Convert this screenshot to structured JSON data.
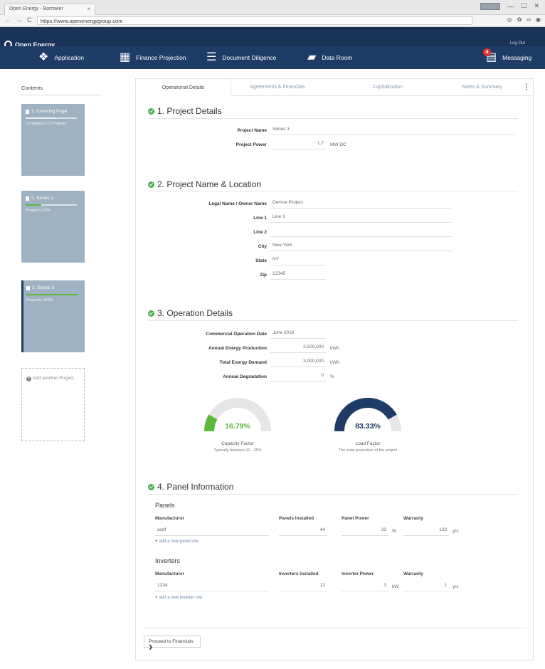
{
  "browser": {
    "tab_title": "Open Energy - Borrower",
    "tab_close": "×",
    "url": "https://www.openenergygroup.com",
    "nav_back": "←",
    "nav_forward": "→",
    "nav_reload": "C",
    "win_min": "—",
    "win_max": "☐",
    "win_close": "✕"
  },
  "app": {
    "brand": "Open Energy",
    "logout": "Log Out"
  },
  "nav": {
    "application": "Application",
    "finance_projection": "Finance Projection",
    "document_diligence": "Document Diligence",
    "data_room": "Data Room",
    "messaging": "Messaging",
    "message_count": "4"
  },
  "sidebar": {
    "contents_label": "Contents",
    "projects": [
      {
        "title": "1. Covering Page",
        "status": "Completed 1/2 Projects",
        "progress": 0.6
      },
      {
        "title": "2. Series 2",
        "status": "Progress 30%",
        "progress": 0.3
      },
      {
        "title": "3. Series 3",
        "status": "Progress 100%",
        "progress": 1.0
      }
    ],
    "add_project": "Add another Project"
  },
  "tabs": {
    "operational": "Operational Details",
    "agreements": "Agreements & Financials",
    "capitalization": "Capitalization",
    "notes": "Notes & Summary",
    "menu": "⋮"
  },
  "section1": {
    "title": "1. Project Details",
    "project_name_label": "Project Name",
    "project_name": "Series 3",
    "project_power_label": "Project Power",
    "project_power": "1.7",
    "project_power_unit": "MW DC"
  },
  "section2": {
    "title": "2. Project Name & Location",
    "legal_name_label": "Legal Name / Owner Name",
    "legal_name": "Demoe Project",
    "line1_label": "Line 1",
    "line1": "Line 1",
    "line2_label": "Line 2",
    "line2": "",
    "city_label": "City",
    "city": "New York",
    "state_label": "State",
    "state": "NY",
    "zip_label": "Zip",
    "zip": "12345"
  },
  "section3": {
    "title": "3. Operation Details",
    "cod_label": "Commercial Operation Date",
    "cod": "June 2016",
    "aep_label": "Annual Energy Production",
    "aep": "2,500,000",
    "aep_unit": "kWh",
    "ted_label": "Total Energy Demand",
    "ted": "3,000,000",
    "ted_unit": "kWh",
    "deg_label": "Annual Degradation",
    "deg": "0",
    "deg_unit": "%",
    "capacity": {
      "value": "16.79%",
      "fraction": 0.1679,
      "label": "Capacity Factor",
      "sub": "Typically between 10 - 25%",
      "color": "#5cb83d"
    },
    "load": {
      "value": "83.33%",
      "fraction": 0.8333,
      "label": "Load Factor",
      "sub": "The solar proportion of the project",
      "color": "#1f3c66"
    }
  },
  "section4": {
    "title": "4. Panel Information",
    "panels_title": "Panels",
    "manufacturer_head": "Manufacturer",
    "panels_installed_head": "Panels Installed",
    "panel_power_head": "Panel Power",
    "warranty_head": "Warranty",
    "panel_row": {
      "manufacturer": "asdf",
      "installed": "44",
      "power": "33",
      "power_unit": "W",
      "warranty": "123",
      "warranty_unit": "yrs"
    },
    "add_panel": "add a new panel row",
    "inverters_title": "Inverters",
    "inverters_installed_head": "Inverters Installed",
    "inverter_power_head": "Inverter Power",
    "inverter_row": {
      "manufacturer": "1234",
      "installed": "12",
      "power": "3",
      "power_unit": "kW",
      "warranty": "1",
      "warranty_unit": "yrs"
    },
    "add_inverter": "add a new inverter row"
  },
  "footer": {
    "proceed": "Proceed to Financials",
    "arrow": "❯"
  }
}
